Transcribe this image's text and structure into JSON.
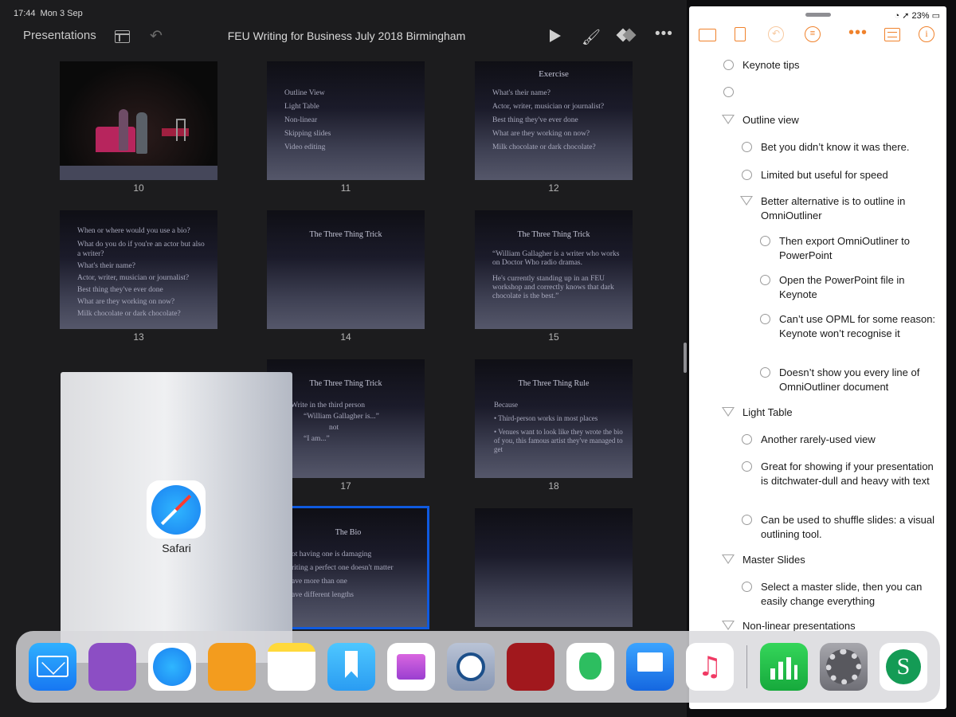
{
  "status": {
    "time": "17:44",
    "date": "Mon 3 Sep",
    "battery": "23%"
  },
  "keynote": {
    "back_label": "Presentations",
    "title": "FEU Writing for Business July 2018 Birmingham",
    "slides": [
      {
        "num": "10",
        "head": "",
        "lines": []
      },
      {
        "num": "11",
        "head": "",
        "lines": [
          "Outline View",
          "Light Table",
          "Non-linear",
          "Skipping slides",
          "Video editing"
        ]
      },
      {
        "num": "12",
        "head": "Exercise",
        "lines": [
          "What's their name?",
          "Actor, writer, musician or journalist?",
          "Best thing they've ever done",
          "What are they working on now?",
          "Milk chocolate or dark chocolate?"
        ]
      },
      {
        "num": "13",
        "head": "",
        "lines": [
          "When or where would you use a bio?",
          "What do you do if you're an actor but also a writer?",
          "What's their name?",
          "Actor, writer, musician or journalist?",
          "Best thing they've ever done",
          "What are they working on now?",
          "Milk chocolate or dark chocolate?"
        ]
      },
      {
        "num": "14",
        "head": "The Three Thing Trick",
        "lines": []
      },
      {
        "num": "15",
        "head": "The Three Thing Trick",
        "lines": [
          "“William Gallagher is a writer who works on Doctor Who radio dramas.",
          "He's currently standing up in an FEU workshop and correctly knows that dark chocolate is the best.”"
        ]
      },
      {
        "num": "17",
        "head": "The Three Thing Trick",
        "lines": [
          "Write in the third person",
          "“William Gallagher is...”",
          "not",
          "“I am...”"
        ]
      },
      {
        "num": "18",
        "head": "The Three Thing Rule",
        "lines": [
          "Because",
          "• Third-person works in most places",
          "• Venues want to look like they wrote the bio of you, this famous artist they've managed to get"
        ]
      },
      {
        "num": "",
        "head": "The Bio",
        "lines": [
          "ot having one is damaging",
          "riting a perfect one doesn't matter",
          "ave more than one",
          "ave different lengths"
        ]
      }
    ]
  },
  "switcher": {
    "app_label": "Safari"
  },
  "outliner": {
    "rows": [
      {
        "text": "Keynote tips",
        "type": "bullet"
      },
      {
        "text": "",
        "type": "bullet"
      },
      {
        "text": "Outline view",
        "type": "tri"
      },
      {
        "text": "Bet you didn’t know it was there.",
        "type": "bullet"
      },
      {
        "text": "Limited but useful for speed",
        "type": "bullet"
      },
      {
        "text": "Better alternative is to outline in OmniOutliner",
        "type": "tri"
      },
      {
        "text": "Then export OmniOutliner to PowerPoint",
        "type": "bullet"
      },
      {
        "text": "Open the PowerPoint file in Keynote",
        "type": "bullet"
      },
      {
        "text": "Can’t use OPML for some reason: Keynote won’t recognise it",
        "type": "bullet"
      },
      {
        "text": "Doesn’t show you every line of OmniOutliner document",
        "type": "bullet"
      },
      {
        "text": "Light Table",
        "type": "tri"
      },
      {
        "text": "Another rarely-used view",
        "type": "bullet"
      },
      {
        "text": "Great for showing if your presentation is ditchwater-dull and heavy with text",
        "type": "bullet"
      },
      {
        "text": "Can be used to shuffle slides: a visual outlining tool.",
        "type": "bullet"
      },
      {
        "text": "Master Slides",
        "type": "tri"
      },
      {
        "text": "Select a master slide, then you can easily change everything",
        "type": "bullet"
      },
      {
        "text": "Non-linear presentations",
        "type": "tri"
      }
    ]
  },
  "dock": {
    "apps": [
      "mail",
      "omnifocus",
      "safari",
      "omnioutliner",
      "notes",
      "bookmarks",
      "stack",
      "1password",
      "spy",
      "evernote",
      "keynote",
      "music",
      "numbers",
      "settings",
      "scrivener"
    ]
  },
  "colors": {
    "accent": "#f0822c",
    "selection": "#0f5ae0"
  }
}
